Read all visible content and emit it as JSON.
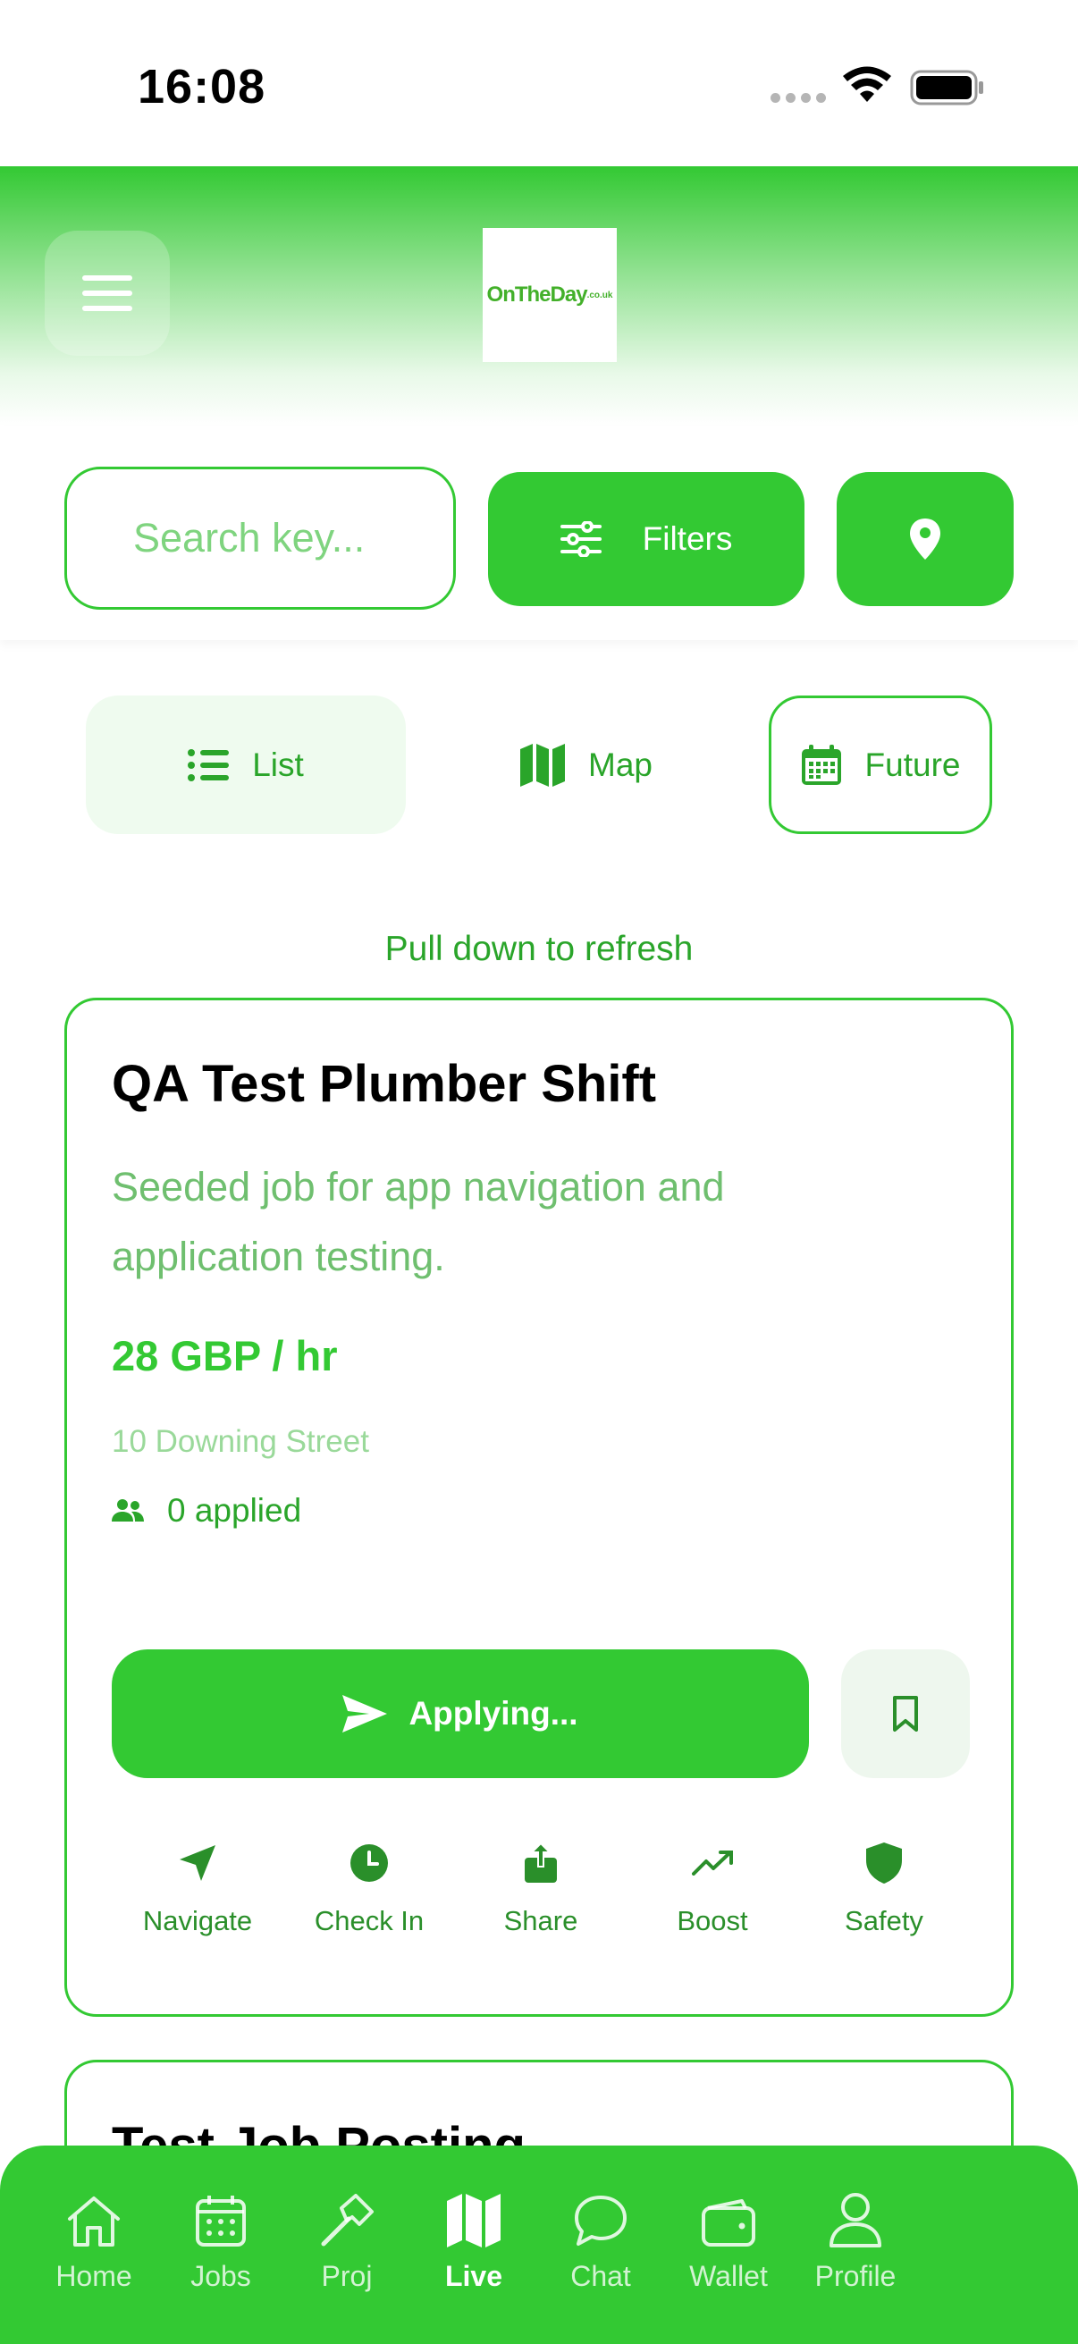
{
  "status_bar": {
    "time": "16:08"
  },
  "header": {
    "logo_text": "OnTheDay",
    "logo_suffix": ".co.uk"
  },
  "search": {
    "placeholder": "Search key...",
    "filters_label": "Filters"
  },
  "view_toggle": {
    "list_label": "List",
    "map_label": "Map",
    "future_label": "Future",
    "selected": "List"
  },
  "refresh_hint": "Pull down to refresh",
  "jobs": [
    {
      "title": "QA Test Plumber Shift",
      "description": "Seeded job for app navigation and application testing.",
      "rate": "28 GBP / hr",
      "address": "10 Downing Street",
      "applied": "0 applied",
      "apply_label": "Applying...",
      "actions": [
        "Navigate",
        "Check In",
        "Share",
        "Boost",
        "Safety"
      ]
    },
    {
      "title": "Test Job Posting"
    }
  ],
  "bottom_nav": {
    "items": [
      "Home",
      "Jobs",
      "Proj",
      "Live",
      "Chat",
      "Wallet",
      "Profile"
    ],
    "active": "Live"
  },
  "colors": {
    "accent": "#33c933",
    "accent_dark": "#2aa52a",
    "muted_text": "#6fbf6f",
    "pale": "#effbef"
  }
}
